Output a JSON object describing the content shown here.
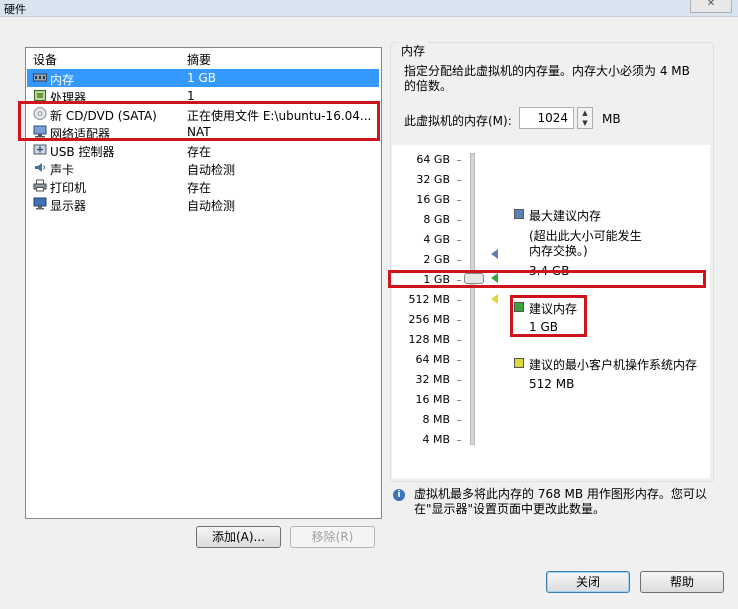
{
  "window": {
    "title": "硬件",
    "close_glyph": "✕"
  },
  "devices": {
    "headers": {
      "device": "设备",
      "summary": "摘要"
    },
    "rows": [
      {
        "icon": "memory-icon",
        "name": "内存",
        "summary": "1 GB",
        "selected": true
      },
      {
        "icon": "processor-icon",
        "name": "处理器",
        "summary": "1"
      },
      {
        "icon": "cd-dvd-icon",
        "name": "新 CD/DVD (SATA)",
        "summary": "正在使用文件 E:\\ubuntu-16.04..."
      },
      {
        "icon": "network-adapter-icon",
        "name": "网络适配器",
        "summary": "NAT"
      },
      {
        "icon": "usb-icon",
        "name": "USB 控制器",
        "summary": "存在"
      },
      {
        "icon": "sound-icon",
        "name": "声卡",
        "summary": "自动检测"
      },
      {
        "icon": "printer-icon",
        "name": "打印机",
        "summary": "存在"
      },
      {
        "icon": "display-icon",
        "name": "显示器",
        "summary": "自动检测"
      }
    ],
    "add_button": "添加(A)...",
    "remove_button": "移除(R)"
  },
  "memory": {
    "group_label": "内存",
    "description": "指定分配给此虚拟机的内存量。内存大小必须为 4 MB 的倍数。",
    "input_label": "此虚拟机的内存(M):",
    "value": "1024",
    "unit": "MB",
    "scale_labels": [
      "64 GB",
      "32 GB",
      "16 GB",
      "8 GB",
      "4 GB",
      "2 GB",
      "1 GB",
      "512 MB",
      "256 MB",
      "128 MB",
      "64 MB",
      "32 MB",
      "16 MB",
      "8 MB",
      "4 MB"
    ],
    "legend": {
      "max_title": "最大建议内存",
      "max_note": "(超出此大小可能发生内存交换。)",
      "max_value": "3.4 GB",
      "rec_title": "建议内存",
      "rec_value": "1 GB",
      "min_title": "建议的最小客户机操作系统内存",
      "min_value": "512 MB"
    },
    "colors": {
      "max": "#5b7fb6",
      "rec": "#3aa33a",
      "min": "#d9d93a"
    },
    "info": "虚拟机最多将此内存的 768 MB 用作图形内存。您可以在\"显示器\"设置页面中更改此数量。"
  },
  "footer": {
    "close_button": "关闭",
    "help_button": "帮助"
  }
}
